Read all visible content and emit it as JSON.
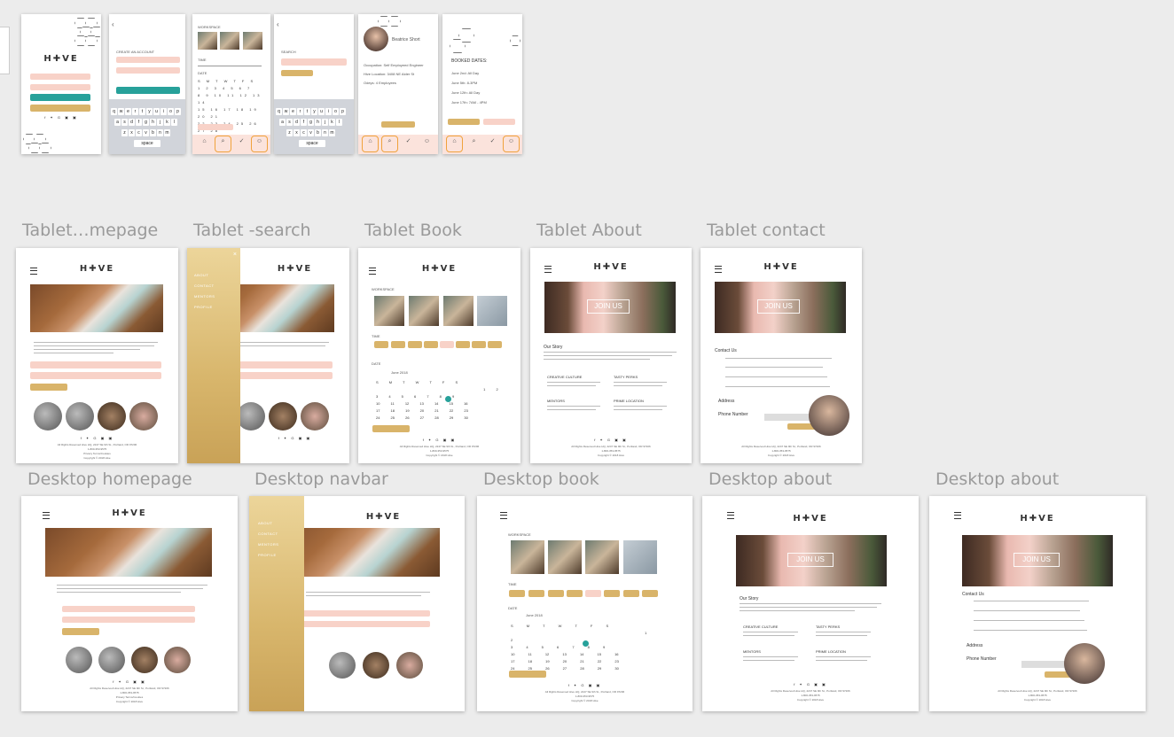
{
  "labels": {
    "tablet_home": "Tablet…mepage",
    "tablet_search": "Tablet -search",
    "tablet_book": "Tablet Book",
    "tablet_about": "Tablet About",
    "tablet_contact": "Tablet contact",
    "desktop_home": "Desktop homepage",
    "desktop_navbar": "Desktop navbar",
    "desktop_book": "Desktop book",
    "desktop_about1": "Desktop about",
    "desktop_about2": "Desktop about"
  },
  "brand": {
    "logo": "H✚VE",
    "accent_gold": "#d9b46a",
    "accent_pink": "#f8d2c8",
    "accent_teal": "#27a19a"
  },
  "mobile": {
    "create_account": "CREATE AN ACCOUNT",
    "workspace": "WORKSPACE",
    "time": "TIME",
    "date": "DATE",
    "search": "SEARCH",
    "profile_name": "Beatrice Short",
    "occupation": "Occupation: Self Employeed Engineer",
    "hive_location": "Hive Location: 3408 NE Alder St",
    "odeys": "Odeys: 4 Employees",
    "booked_dates": "BOOKED DATES:",
    "booked": [
      "June 2nd: All Day",
      "June 5th: 8-3PM",
      "June 12th: All Day",
      "June 17th: 7AM - 4PM"
    ],
    "month": "June 2018",
    "tabs": [
      "HOME",
      "SEARCH",
      "BOOKING",
      "PROFILE"
    ]
  },
  "tablet": {
    "workspace": "WORKSPACE",
    "time": "TIME",
    "date": "DATE",
    "month": "June 2018",
    "join_us": "JOIN US",
    "our_story": "Our Story",
    "creative_culture": "CREATIVE CULTURE",
    "tasty_perks": "TASTY PERKS",
    "mentors": "MENTORS",
    "prime_location": "PRIME LOCATION",
    "contact_us": "Contact Us",
    "address": "Address",
    "phone_number": "Phone Number",
    "check_availability": "CHECK AVAILABILITY",
    "menu": [
      "ABOUT",
      "CONTACT",
      "MENTORS",
      "PROFILE"
    ],
    "footer": [
      "All Rights Reserved Hive HQ, 2247 SE 9th St., Portland, OR 97206",
      "1-800-353-9575",
      "Privacy Terms/Cookies",
      "Copyright © 2018 Hive"
    ]
  }
}
